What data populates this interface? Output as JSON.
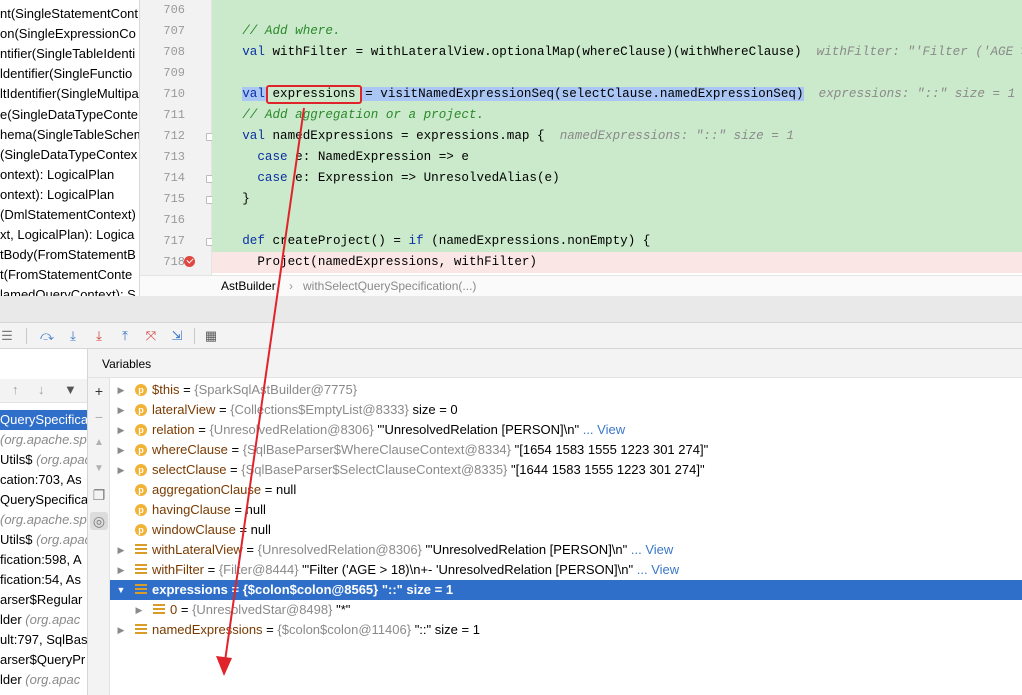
{
  "structure": {
    "items": [
      "nt(SingleStatementCont",
      "on(SingleExpressionCo",
      "ntifier(SingleTableIdenti",
      "ldentifier(SingleFunctio",
      "ltIdentifier(SingleMultipa",
      "e(SingleDataTypeConte",
      "hema(SingleTableSchem",
      "(SingleDataTypeContex",
      "ontext): LogicalPlan",
      "ontext): LogicalPlan",
      "(DmlStatementContext)",
      "xt, LogicalPlan): Logica",
      "tBody(FromStatementB",
      "t(FromStatementConte",
      "lamedQueryContext): S"
    ]
  },
  "editor": {
    "line_numbers": [
      "706",
      "707",
      "708",
      "709",
      "710",
      "711",
      "712",
      "713",
      "714",
      "715",
      "716",
      "717",
      "718"
    ],
    "line707_comment": "// Add where.",
    "line708_kw": "val",
    "line708_code": " withFilter = withLateralView.optionalMap(whereClause)(withWhereClause)",
    "line708_hint": "withFilter: \"'Filter ('AGE > 18)",
    "line710_kw": "val",
    "line710_var": "expressions",
    "line710_code": " = visitNamedExpressionSeq(selectClause.namedExpressionSeq)",
    "line710_hint": "expressions: \"::\" size = 1",
    "line711_comment": "// Add aggregation or a project.",
    "line712_kw": "val",
    "line712_code": " namedExpressions = expressions.map {",
    "line712_hint": "namedExpressions: \"::\" size = 1",
    "line713_kw": "case",
    "line713_code": " e: NamedExpression => e",
    "line714_kw": "case",
    "line714_code": " e: Expression => UnresolvedAlias(e)",
    "line715_code": "}",
    "line717_kw": "def",
    "line717_code_a": " createProject() = ",
    "line717_kw2": "if",
    "line717_code_b": " (namedExpressions.nonEmpty) {",
    "line718_code": "Project(namedExpressions, withFilter)"
  },
  "breadcrumb": {
    "first": "AstBuilder",
    "separator": "›",
    "second": "withSelectQuerySpecification(...)"
  },
  "debugger": {
    "toolbar_icons": [
      "console-icon",
      "step-over-icon",
      "step-into-icon",
      "force-step-into-icon",
      "step-out-icon",
      "drop-frame-icon",
      "run-to-cursor-icon",
      "evaluate-icon"
    ]
  },
  "frames": {
    "rows": [
      {
        "text": "QuerySpecificati",
        "italic": "",
        "selected": true
      },
      {
        "text": "",
        "italic": "(org.apache.spa",
        "selected": false
      },
      {
        "text": "Utils$ ",
        "italic": "(org.apac",
        "selected": false
      },
      {
        "text": "cation:703, As",
        "italic": "",
        "selected": false
      },
      {
        "text": "QuerySpecifica",
        "italic": "",
        "selected": false
      },
      {
        "text": "",
        "italic": "(org.apache.sp",
        "selected": false
      },
      {
        "text": "Utils$ ",
        "italic": "(org.apac",
        "selected": false
      },
      {
        "text": "fication:598, A",
        "italic": "",
        "selected": false
      },
      {
        "text": "fication:54, As",
        "italic": "",
        "selected": false
      },
      {
        "text": "arser$Regular",
        "italic": "",
        "selected": false
      },
      {
        "text": "lder ",
        "italic": "(org.apac",
        "selected": false
      },
      {
        "text": "ult:797, SqlBas",
        "italic": "",
        "selected": false
      },
      {
        "text": "arser$QueryPr",
        "italic": "",
        "selected": false
      },
      {
        "text": "lder ",
        "italic": "(org.apac",
        "selected": false
      }
    ]
  },
  "variables": {
    "title": "Variables",
    "rows": [
      {
        "icon": "p",
        "expand": true,
        "indent": 0,
        "name": "$this",
        "eq": " = ",
        "type": "{SparkSqlAstBuilder@7775}",
        "value": "",
        "link": "",
        "selected": false
      },
      {
        "icon": "p",
        "expand": true,
        "indent": 0,
        "name": "lateralView",
        "eq": " = ",
        "type": "{Collections$EmptyList@8333}",
        "value": "  size = 0",
        "link": "",
        "selected": false
      },
      {
        "icon": "p",
        "expand": true,
        "indent": 0,
        "name": "relation",
        "eq": " = ",
        "type": "{UnresolvedRelation@8306}",
        "value": " \"'UnresolvedRelation [PERSON]\\n\"",
        "link": " ... View",
        "selected": false
      },
      {
        "icon": "p",
        "expand": true,
        "indent": 0,
        "name": "whereClause",
        "eq": " = ",
        "type": "{SqlBaseParser$WhereClauseContext@8334}",
        "value": " \"[1654 1583 1555 1223 301 274]\"",
        "link": "",
        "selected": false
      },
      {
        "icon": "p",
        "expand": true,
        "indent": 0,
        "name": "selectClause",
        "eq": " = ",
        "type": "{SqlBaseParser$SelectClauseContext@8335}",
        "value": " \"[1644 1583 1555 1223 301 274]\"",
        "link": "",
        "selected": false
      },
      {
        "icon": "p",
        "expand": false,
        "indent": 0,
        "name": "aggregationClause",
        "eq": " = ",
        "type": "",
        "value": "null",
        "link": "",
        "selected": false
      },
      {
        "icon": "p",
        "expand": false,
        "indent": 0,
        "name": "havingClause",
        "eq": " = ",
        "type": "",
        "value": "null",
        "link": "",
        "selected": false
      },
      {
        "icon": "p",
        "expand": false,
        "indent": 0,
        "name": "windowClause",
        "eq": " = ",
        "type": "",
        "value": "null",
        "link": "",
        "selected": false
      },
      {
        "icon": "f",
        "expand": true,
        "indent": 0,
        "name": "withLateralView",
        "eq": " = ",
        "type": "{UnresolvedRelation@8306}",
        "value": " \"'UnresolvedRelation [PERSON]\\n\"",
        "link": " ... View",
        "selected": false
      },
      {
        "icon": "f",
        "expand": true,
        "indent": 0,
        "name": "withFilter",
        "eq": " = ",
        "type": "{Filter@8444}",
        "value": " \"'Filter ('AGE > 18)\\n+- 'UnresolvedRelation [PERSON]\\n\"",
        "link": " ... View",
        "selected": false
      },
      {
        "icon": "f",
        "expand": true,
        "indent": 0,
        "name": "expressions",
        "eq": " = ",
        "type": "{$colon$colon@8565}",
        "value": " \"::\" size = 1",
        "link": "",
        "selected": true
      },
      {
        "icon": "f",
        "expand": true,
        "indent": 1,
        "name": "0",
        "eq": " = ",
        "type": "{UnresolvedStar@8498}",
        "value": " \"*\"",
        "link": "",
        "selected": false
      },
      {
        "icon": "f",
        "expand": true,
        "indent": 0,
        "name": "namedExpressions",
        "eq": " = ",
        "type": "{$colon$colon@11406}",
        "value": " \"::\" size = 1",
        "link": "",
        "selected": false
      }
    ]
  },
  "colors": {
    "accent": "#2f6fc9",
    "changed_lines": "#cbe9cb",
    "annotation_red": "#e0242b"
  }
}
